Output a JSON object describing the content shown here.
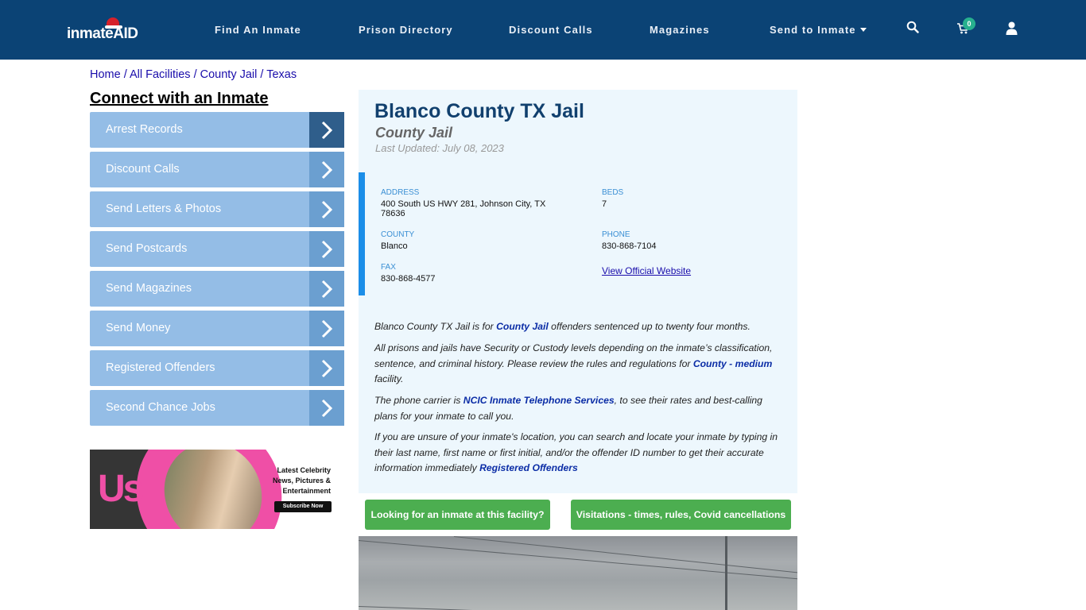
{
  "header": {
    "logo_text": "inmate",
    "logo_text_accent": "AID",
    "nav": [
      {
        "label": "Find An Inmate"
      },
      {
        "label": "Prison Directory"
      },
      {
        "label": "Discount Calls"
      },
      {
        "label": "Magazines"
      },
      {
        "label": "Send to Inmate",
        "has_dropdown": true
      }
    ],
    "icons": [
      "search-icon",
      "cart-icon",
      "user-icon"
    ],
    "cart_count": "0"
  },
  "breadcrumb": [
    {
      "label": "Home"
    },
    {
      "label": "All Facilities"
    },
    {
      "label": "County Jail"
    },
    {
      "label": "Texas"
    }
  ],
  "breadcrumb_separator": "/",
  "sidebar": {
    "title": "Connect with an Inmate",
    "items": [
      {
        "label": "Arrest Records"
      },
      {
        "label": "Discount Calls"
      },
      {
        "label": "Send Letters & Photos"
      },
      {
        "label": "Send Postcards"
      },
      {
        "label": "Send Magazines"
      },
      {
        "label": "Send Money"
      },
      {
        "label": "Registered Offenders"
      },
      {
        "label": "Second Chance Jobs"
      }
    ],
    "ad": {
      "brand": "Us",
      "headline": "Latest Celebrity News, Pictures & Entertainment",
      "cta": "Subscribe Now"
    }
  },
  "facility": {
    "title": "Blanco County TX Jail",
    "type": "County Jail",
    "last_updated": "Last Updated: July 08, 2023",
    "fields": {
      "address_label": "ADDRESS",
      "address_value": "400 South US HWY 281, Johnson City, TX 78636",
      "beds_label": "BEDS",
      "beds_value": "7",
      "county_label": "COUNTY",
      "county_value": "Blanco",
      "phone_label": "PHONE",
      "phone_value": "830-868-7104",
      "fax_label": "FAX",
      "fax_value": "830-868-4577",
      "website_link": "View Official Website"
    },
    "paragraphs": {
      "p1_a": "Blanco County TX Jail is for ",
      "p1_link": "County Jail",
      "p1_b": " offenders sentenced up to twenty four months.",
      "p2_a": "All prisons and jails have Security or Custody levels depending on the inmate’s classification, sentence, and criminal history. Please review the rules and regulations for ",
      "p2_link": "County - medium",
      "p2_b": " facility.",
      "p3_a": "The phone carrier is ",
      "p3_link": "NCIC Inmate Telephone Services",
      "p3_b": ", to see their rates and best-calling plans for your inmate to call you.",
      "p4_a": "If you are unsure of your inmate's location, you can search and locate your inmate by typing in their last name, first name or first initial, and/or the offender ID number to get their accurate information immediately ",
      "p4_link": "Registered Offenders"
    },
    "buttons": {
      "find_inmate": "Looking for an inmate at this facility?",
      "visitation": "Visitations - times, rules, Covid cancellations"
    }
  },
  "colors": {
    "header_bg": "#0b4375",
    "sidebar_item": "#94bde6",
    "sidebar_arrow": "#6b9fd0",
    "panel_bg": "#edf7fd",
    "accent_bar": "#1b8ee8",
    "green_button": "#4cae50",
    "title": "#11406e"
  }
}
